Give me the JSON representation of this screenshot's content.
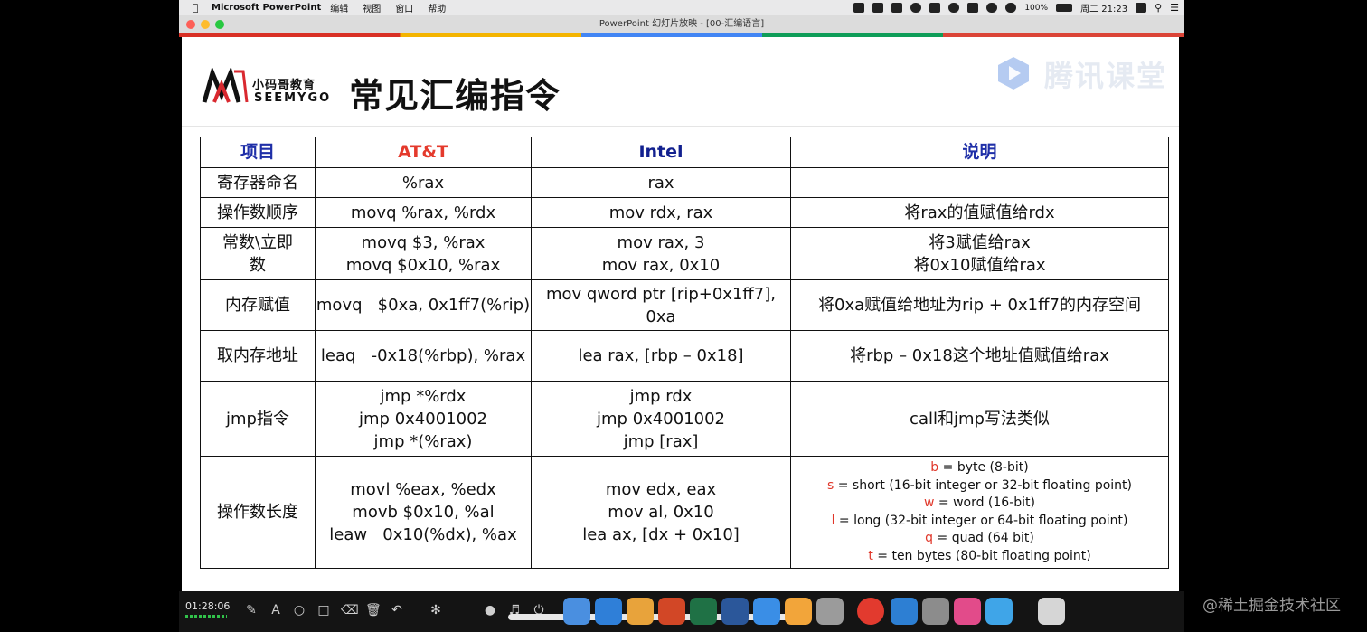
{
  "menubar": {
    "app_name": "Microsoft PowerPoint",
    "menus": [
      "编辑",
      "视图",
      "窗口",
      "帮助"
    ],
    "battery": "100%",
    "clock": "周二 21:23"
  },
  "window": {
    "title": "PowerPoint 幻灯片放映 - [00-汇编语言]"
  },
  "watermark": {
    "text": "腾讯课堂"
  },
  "logo": {
    "cn": "小码哥教育",
    "en": "SEEMYGO"
  },
  "slide": {
    "title": "常见汇编指令",
    "table": {
      "headers": {
        "item": "项目",
        "att": "AT&T",
        "intel": "Intel",
        "desc": "说明"
      },
      "rows": [
        {
          "item": [
            "寄存器命名"
          ],
          "att": [
            "%rax"
          ],
          "intel": [
            "rax"
          ],
          "desc": [
            ""
          ]
        },
        {
          "item": [
            "操作数顺序"
          ],
          "att": [
            "movq %rax, %rdx"
          ],
          "intel": [
            "mov rdx, rax"
          ],
          "desc": [
            "将rax的值赋值给rdx"
          ]
        },
        {
          "item": [
            "常数\\立即",
            "数"
          ],
          "att": [
            "movq $3, %rax",
            "movq $0x10, %rax"
          ],
          "intel": [
            "mov rax, 3",
            "mov rax, 0x10"
          ],
          "desc": [
            "将3赋值给rax",
            "将0x10赋值给rax"
          ]
        },
        {
          "item": [
            "内存赋值"
          ],
          "att": [
            "movq   $0xa, 0x1ff7(%rip)"
          ],
          "intel": [
            "mov qword ptr [rip+0x1ff7], 0xa"
          ],
          "desc": [
            "将0xa赋值给地址为rip + 0x1ff7的内存空间"
          ]
        },
        {
          "item": [
            "取内存地址"
          ],
          "att": [
            "leaq   -0x18(%rbp), %rax"
          ],
          "intel": [
            "lea rax, [rbp – 0x18]"
          ],
          "desc": [
            "将rbp – 0x18这个地址值赋值给rax"
          ]
        },
        {
          "item": [
            "jmp指令"
          ],
          "att": [
            "jmp *%rdx",
            "jmp 0x4001002",
            "jmp *(%rax)"
          ],
          "intel": [
            "jmp rdx",
            "jmp 0x4001002",
            "jmp [rax]"
          ],
          "desc": [
            "call和jmp写法类似"
          ]
        },
        {
          "item": [
            "操作数长度"
          ],
          "att": [
            "movl %eax, %edx",
            "movb $0x10, %al",
            "leaw   0x10(%dx), %ax"
          ],
          "intel": [
            "mov edx, eax",
            "mov al, 0x10",
            "lea ax, [dx + 0x10]"
          ],
          "suffixes": [
            {
              "key": "b",
              "text": " = byte (8-bit)"
            },
            {
              "key": "s",
              "text": " = short (16-bit integer or 32-bit floating point)"
            },
            {
              "key": "w",
              "text": " = word (16-bit)"
            },
            {
              "key": "l",
              "text": " = long (32-bit integer or 64-bit floating point)"
            },
            {
              "key": "q",
              "text": " = quad (64 bit)"
            },
            {
              "key": "t",
              "text": " = ten bytes (80-bit floating point)"
            }
          ]
        }
      ]
    }
  },
  "player": {
    "elapsed": "01:28:06"
  },
  "page_watermark": "@稀土掘金技术社区",
  "colors": {
    "att_header": "#e43a2c",
    "intel_header": "#12208f",
    "blue_header": "#1f2fa8",
    "suffix_key": "#e0372a"
  }
}
